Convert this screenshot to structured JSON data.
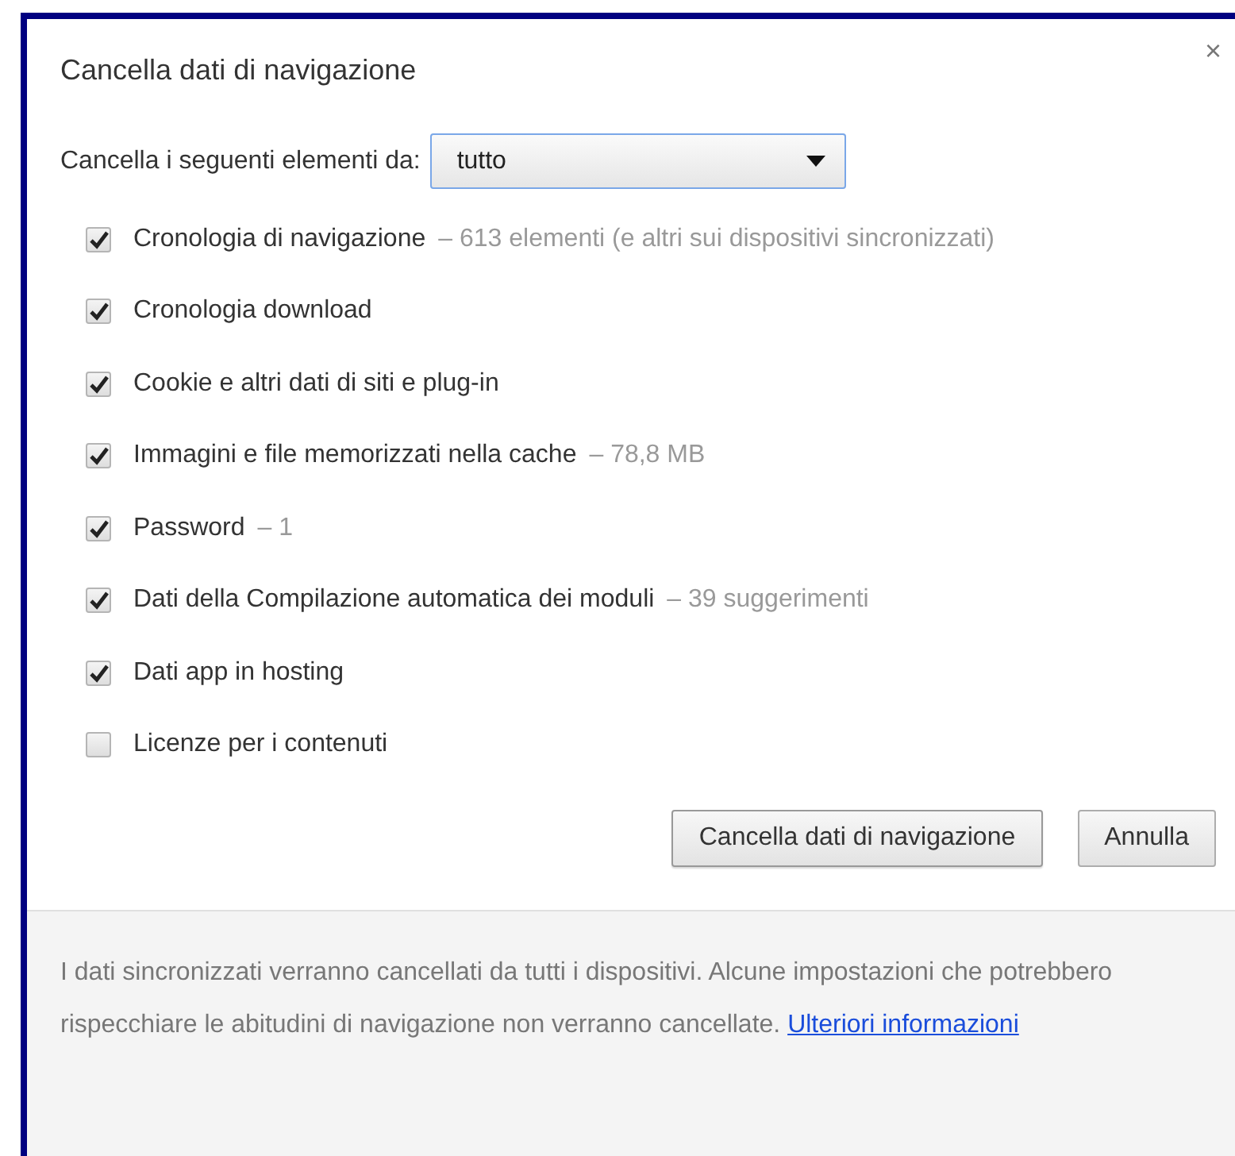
{
  "dialog": {
    "title": "Cancella dati di navigazione",
    "close": "×"
  },
  "range": {
    "label": "Cancella i seguenti elementi da:",
    "value": "tutto"
  },
  "items": [
    {
      "label": "Cronologia di navigazione",
      "detail": "– 613 elementi (e altri sui dispositivi sincronizzati)",
      "checked": true
    },
    {
      "label": "Cronologia download",
      "checked": true
    },
    {
      "label": "Cookie e altri dati di siti e plug-in",
      "checked": true
    },
    {
      "label": "Immagini e file memorizzati nella cache",
      "detail": "– 78,8 MB",
      "checked": true
    },
    {
      "label": "Password",
      "detail": "– 1",
      "checked": true
    },
    {
      "label": "Dati della Compilazione automatica dei moduli",
      "detail": "– 39 suggerimenti",
      "checked": true
    },
    {
      "label": "Dati app in hosting",
      "checked": true
    },
    {
      "label": "Licenze per i contenuti",
      "checked": false
    }
  ],
  "buttons": [
    {
      "label": "Cancella dati di navigazione",
      "kind": "primary"
    },
    {
      "label": "Annulla",
      "kind": "cancel"
    }
  ],
  "footer": {
    "text": "I dati sincronizzati verranno cancellati da tutti i dispositivi. Alcune impostazioni che potrebbero rispecchiare le abitudini di navigazione non verranno cancellate.",
    "link": "Ulteriori informazioni"
  }
}
